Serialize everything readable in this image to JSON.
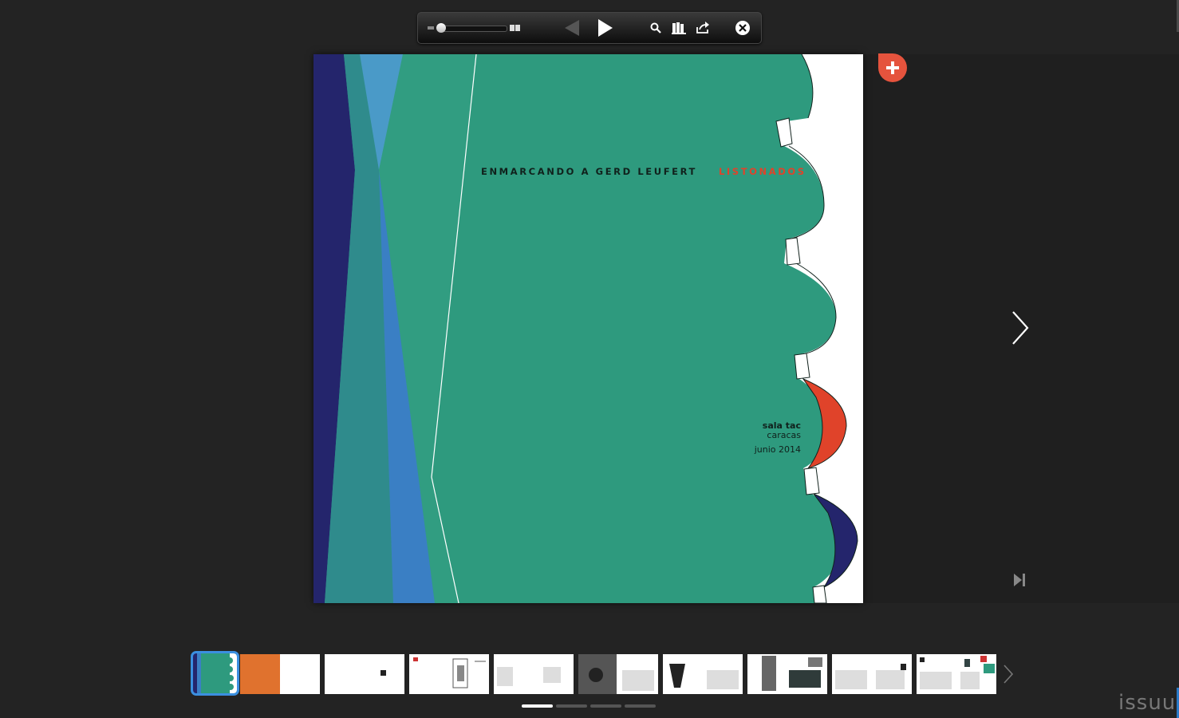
{
  "toolbar": {
    "buttons": [
      "zoom-slider",
      "two-page-view-icon",
      "previous-arrow-icon",
      "play-icon",
      "search-icon",
      "library-icon",
      "share-icon",
      "close-icon"
    ]
  },
  "cover": {
    "title": "ENMARCANDO A GERD LEUFERT",
    "series": "LISTONADOS",
    "venue": "sala tac",
    "city": "caracas",
    "date": "junio 2014"
  },
  "colors": {
    "green": "#2e9a7e",
    "navy": "#24256c",
    "blue": "#3a7fc4",
    "red": "#e0432a",
    "add_button": "#e5533d",
    "selected_thumb": "#3b8fe0"
  },
  "thumbnails": {
    "count": 10,
    "selected_index": 0
  },
  "pager": {
    "pages": 4,
    "active": 0
  },
  "brand": "issuu"
}
